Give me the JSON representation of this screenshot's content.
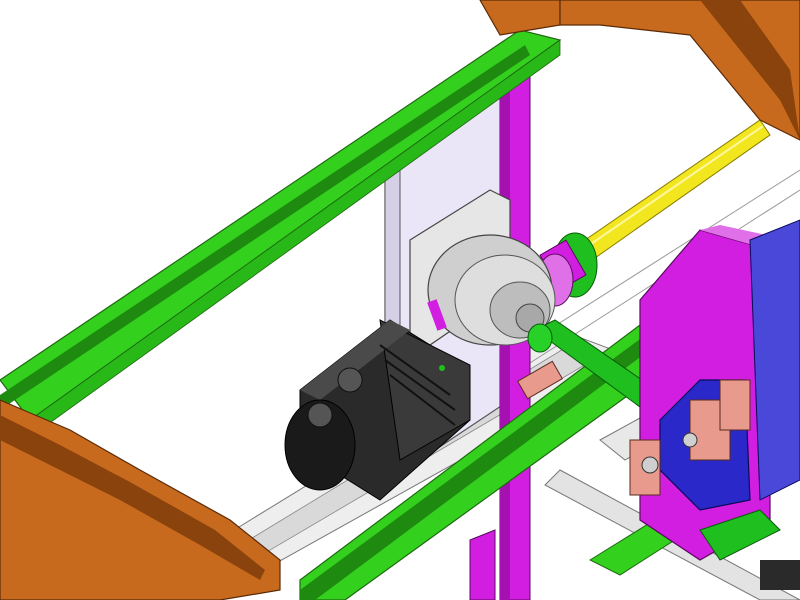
{
  "scene": {
    "description_free": true,
    "background": "#ffffff",
    "colors": {
      "frame_brown": "#c86a1e",
      "frame_brown_dark": "#8a430c",
      "rail_green": "#33d11e",
      "rail_green_dark": "#1e8a10",
      "post_magenta": "#d21ee0",
      "plate_lavender": "#ebe6f7",
      "shaft_yellow": "#f2e61e",
      "gearbox_gray": "#d6d6d6",
      "motor_black": "#2a2a2a",
      "bracket_blue": "#2a28c8",
      "block_pink": "#e89a8c",
      "rail_gray": "#e6e6e6"
    },
    "parts": [
      "frame-top",
      "frame-left",
      "green-rail-upper",
      "green-rail-lower",
      "magenta-post",
      "mount-plate",
      "yellow-shaft",
      "coupling",
      "gearbox",
      "servo-motor",
      "output-shaft",
      "purple-bracket",
      "blue-bracket",
      "pink-blocks",
      "linear-rails"
    ]
  }
}
